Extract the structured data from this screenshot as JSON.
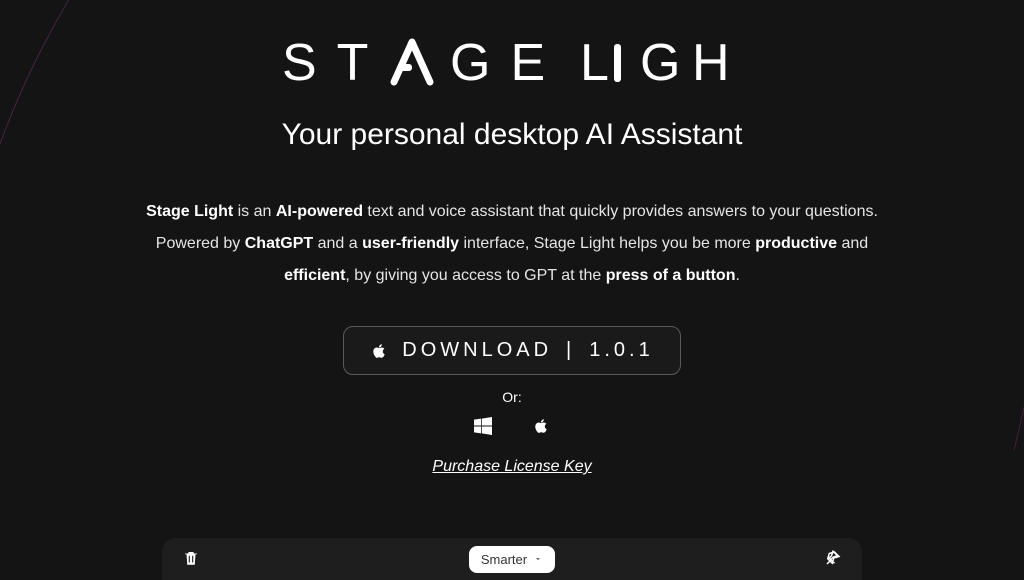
{
  "logo_text": "STAGE LIGHT",
  "subtitle": "Your personal desktop AI Assistant",
  "desc": {
    "p1a": "Stage Light",
    "p1b": " is an ",
    "p1c": "AI-powered",
    "p1d": " text and voice assistant that quickly provides answers to your questions.",
    "p2a": "Powered by ",
    "p2b": "ChatGPT",
    "p2c": " and a ",
    "p2d": "user-friendly",
    "p2e": " interface, Stage Light helps you be more ",
    "p2f": "productive",
    "p2g": " and",
    "p3a": "efficient",
    "p3b": ", by giving you access to GPT at the ",
    "p3c": "press of a button",
    "p3d": "."
  },
  "download": {
    "label": "DOWNLOAD",
    "version": "1.0.1"
  },
  "or_label": "Or:",
  "license_link": "Purchase License Key",
  "dropdown_label": "Smarter"
}
